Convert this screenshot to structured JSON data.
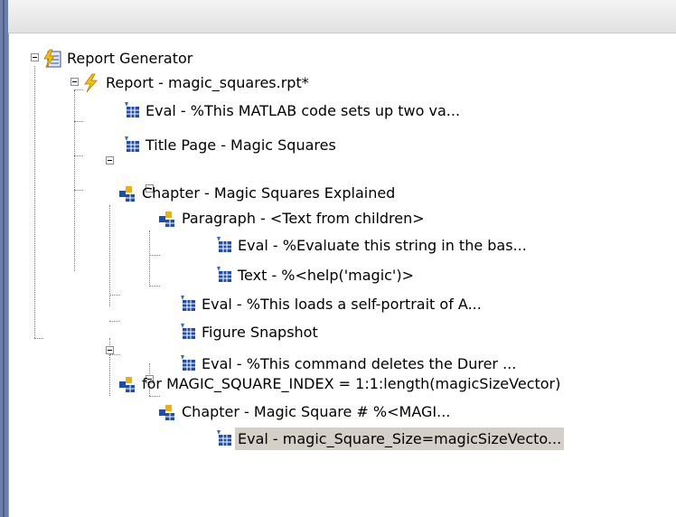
{
  "tree": {
    "root": {
      "label": "Report Generator",
      "icon": "report-generator-icon"
    },
    "report": {
      "label": "Report - magic_squares.rpt*",
      "icon": "lightning-icon"
    },
    "items": [
      {
        "id": "eval-setup",
        "label": "Eval - %This MATLAB code sets up two va...",
        "icon": "table-icon"
      },
      {
        "id": "title-page",
        "label": "Title Page - Magic Squares",
        "icon": "table-icon"
      },
      {
        "id": "chapter-explained",
        "label": "Chapter - Magic Squares Explained",
        "icon": "component-group-icon"
      },
      {
        "id": "paragraph",
        "label": "Paragraph - <Text from children>",
        "icon": "component-group-icon"
      },
      {
        "id": "eval-string",
        "label": "Eval - %Evaluate this string in the bas...",
        "icon": "table-icon"
      },
      {
        "id": "text-help",
        "label": "Text - %<help('magic')>",
        "icon": "table-icon"
      },
      {
        "id": "eval-portrait",
        "label": "Eval - %This loads a self-portrait of A...",
        "icon": "table-icon"
      },
      {
        "id": "figure-snapshot",
        "label": "Figure Snapshot",
        "icon": "table-icon"
      },
      {
        "id": "eval-delete",
        "label": "Eval - %This command deletes the Durer ...",
        "icon": "table-icon"
      },
      {
        "id": "for-loop",
        "label": "for MAGIC_SQUARE_INDEX = 1:1:length(magicSizeVector)",
        "icon": "component-group-icon"
      },
      {
        "id": "chapter-index",
        "label": "Chapter - Magic Square # %<MAGI...",
        "icon": "component-group-icon"
      },
      {
        "id": "eval-size",
        "label": "Eval - magic_Square_Size=magicSizeVecto...",
        "icon": "table-icon",
        "selected": true
      }
    ]
  }
}
